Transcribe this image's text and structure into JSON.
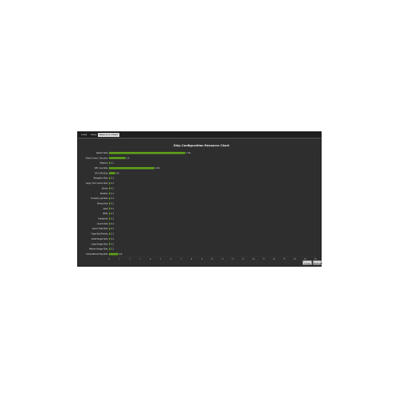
{
  "tabs": [
    {
      "label": "Load"
    },
    {
      "label": "Save"
    },
    {
      "label": "Resource Chart"
    }
  ],
  "buttons": {
    "close_label": "Close",
    "refresh_label": "Refresh"
  },
  "colors": {
    "bar": "#5fa31a",
    "background": "#2e2e2e",
    "text": "#e6e6e6"
  },
  "chart_data": {
    "type": "bar",
    "orientation": "horizontal",
    "title": "Ship Configuration Resource Chart",
    "xlabel": "",
    "ylabel": "",
    "xlim": [
      0,
      20
    ],
    "x_ticks": [
      0,
      1,
      2,
      3,
      4,
      5,
      6,
      7,
      8,
      9,
      10,
      11,
      12,
      13,
      14,
      15,
      16,
      17,
      18,
      19,
      20
    ],
    "categories": [
      "Reactor Slots",
      "Shield / Armor / Structure",
      "Weapons",
      "CPU / Low Slots",
      "CPU / Mid Slots",
      "Navigation Slots",
      "Cargo / Ore / Ammo Slots",
      "Drones",
      "Boosters",
      "Thrusters / Jet Slots",
      "Mining Tools",
      "Jewel",
      "Utility",
      "Hardpoints",
      "Launch Pads",
      "Launch Tube Slots",
      "Cargo Bay Modules",
      "Small Hangar Slots",
      "Large Hangar Slots",
      "Medium Hangar Slots",
      "Computational Flag Slots"
    ],
    "values": [
      7.4,
      1.6,
      0.1,
      4.4,
      0.6,
      0.1,
      0.1,
      0.1,
      0.1,
      0.1,
      0.1,
      0.1,
      0.1,
      0.1,
      0.1,
      0.1,
      0.1,
      0.1,
      0.1,
      0.1,
      0.9
    ],
    "data_labels": [
      "7.4%",
      "1.6",
      "0.1",
      "4.4%",
      "0.6",
      "0.1",
      "0.1",
      "0.1",
      "0.1",
      "0.1",
      "0.1",
      "0.1",
      "0.1",
      "0.1",
      "0.1",
      "0.1",
      "0.1",
      "0.1",
      "0.1",
      "0.1",
      "0.9"
    ],
    "grid": false
  }
}
